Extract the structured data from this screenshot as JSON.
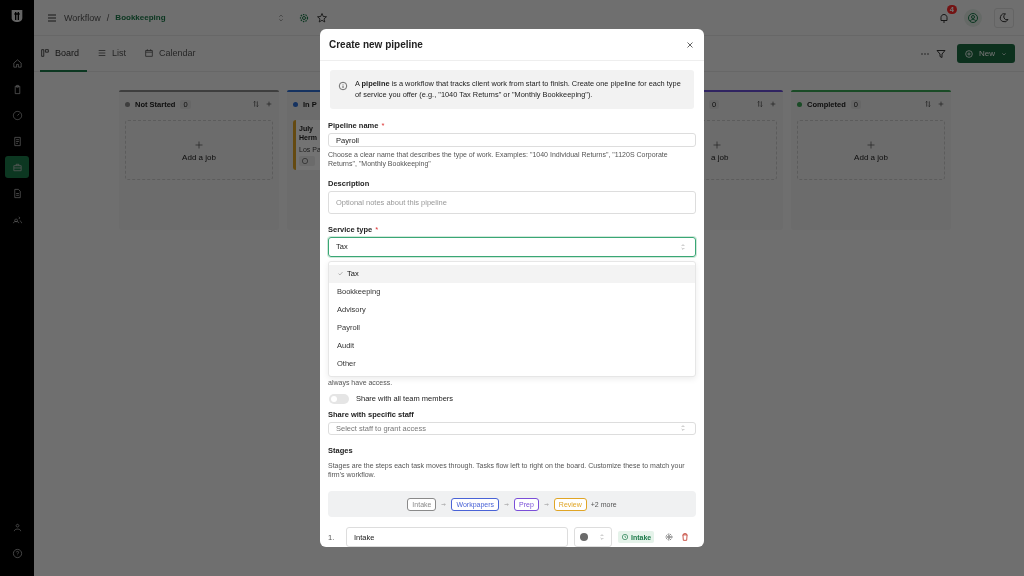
{
  "app_bar": {
    "breadcrumb_root": "Workflow",
    "separator": "/",
    "breadcrumb_current": "Bookkeeping",
    "notification_count": "4"
  },
  "sidebar": {
    "items": [
      {
        "selected": false
      },
      {
        "selected": false
      },
      {
        "selected": false
      },
      {
        "selected": false
      },
      {
        "selected": true
      },
      {
        "selected": false
      },
      {
        "selected": false
      }
    ]
  },
  "view_tabs": [
    {
      "label": "Board",
      "selected": true
    },
    {
      "label": "List",
      "selected": false
    },
    {
      "label": "Calendar",
      "selected": false
    }
  ],
  "toolbar": {
    "new_button": "New"
  },
  "board": {
    "columns": [
      {
        "kind": "full",
        "name": "Not Started",
        "count": "0",
        "color": "#3e3e3e",
        "add_label": "Add a job"
      },
      {
        "kind": "covered",
        "name": "In P",
        "color": "#153260",
        "cards": [
          {
            "title_lines": [
              "July",
              "Herm"
            ],
            "subtitle": "Los Pa"
          }
        ]
      },
      {
        "kind": "partial",
        "count": "0",
        "color": "#302461",
        "add_label": "a job"
      },
      {
        "kind": "full",
        "name": "Completed",
        "count": "0",
        "color": "#1a4b26",
        "add_label": "Add a job"
      }
    ]
  },
  "modal": {
    "title": "Create new pipeline",
    "info": "A **pipeline** is a workflow that tracks client work from start to finish. Create one pipeline for each type of service you offer (e.g., \"1040 Tax Returns\" or \"Monthly Bookkeeping\").",
    "name_field": {
      "label": "Pipeline name",
      "required_mark": "*",
      "value": "Payroll",
      "hint": "Choose a clear name that describes the type of work. Examples: \"1040 Individual Returns\", \"1120S Corporate Returns\", \"Monthly Bookkeeping\""
    },
    "description_field": {
      "label": "Description",
      "placeholder": "Optional notes about this pipeline"
    },
    "service_type": {
      "label": "Service type",
      "required_mark": "*",
      "value": "Tax",
      "expanded": true,
      "options": [
        {
          "label": "Tax",
          "selected": true
        },
        {
          "label": "Bookkeeping",
          "selected": false
        },
        {
          "label": "Advisory",
          "selected": false
        },
        {
          "label": "Payroll",
          "selected": false
        },
        {
          "label": "Audit",
          "selected": false
        },
        {
          "label": "Other",
          "selected": false
        }
      ]
    },
    "access_hint_tail": "always have access.",
    "share_all": {
      "label": "Share with all team members",
      "on": false
    },
    "share_staff": {
      "label": "Share with specific staff",
      "placeholder": "Select staff to grant access"
    },
    "stages": {
      "title": "Stages",
      "description": "Stages are the steps each task moves through. Tasks flow left to right on the board. Customize these to match your firm's workflow.",
      "preview": [
        {
          "label": "Intake",
          "color": "#8a8a8a"
        },
        {
          "label": "Workpapers",
          "color": "#4a63d6"
        },
        {
          "label": "Prep",
          "color": "#7a4fd8"
        },
        {
          "label": "Review",
          "color": "#e0a526"
        }
      ],
      "more": "+2 more",
      "rows": [
        {
          "number": "1.",
          "name": "Intake",
          "color": "#6b6b6b",
          "badge": "Intake"
        }
      ]
    }
  }
}
